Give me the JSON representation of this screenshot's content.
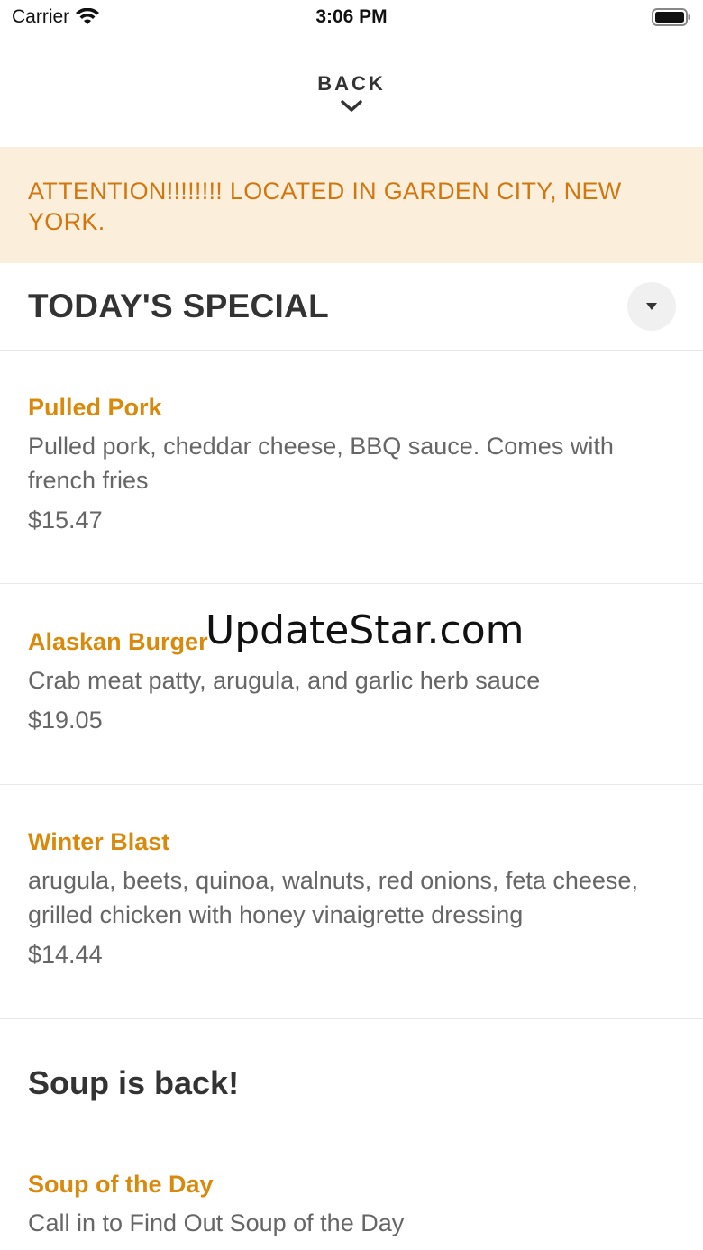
{
  "status_bar": {
    "carrier": "Carrier",
    "time": "3:06 PM"
  },
  "nav": {
    "back_label": "BACK"
  },
  "banner": {
    "text": "ATTENTION!!!!!!!! LOCATED IN GARDEN CITY, NEW YORK."
  },
  "section": {
    "title": "TODAY'S SPECIAL"
  },
  "items": [
    {
      "name": "Pulled Pork",
      "description": "Pulled pork, cheddar cheese, BBQ sauce. Comes with french fries",
      "price": "$15.47"
    },
    {
      "name": "Alaskan Burger",
      "description": "Crab meat patty, arugula, and garlic herb sauce",
      "price": "$19.05"
    },
    {
      "name": "Winter Blast",
      "description": "arugula, beets, quinoa, walnuts, red onions, feta cheese, grilled chicken with honey vinaigrette dressing",
      "price": "$14.44"
    }
  ],
  "subsection": {
    "title": "Soup is back!"
  },
  "soup_item": {
    "name": "Soup of the Day",
    "description": "Call in to Find Out Soup of the Day"
  },
  "watermark": "UpdateStar.com",
  "colors": {
    "accent": "#d98a0c",
    "banner_bg": "#fbefdc",
    "banner_text": "#d27710"
  }
}
